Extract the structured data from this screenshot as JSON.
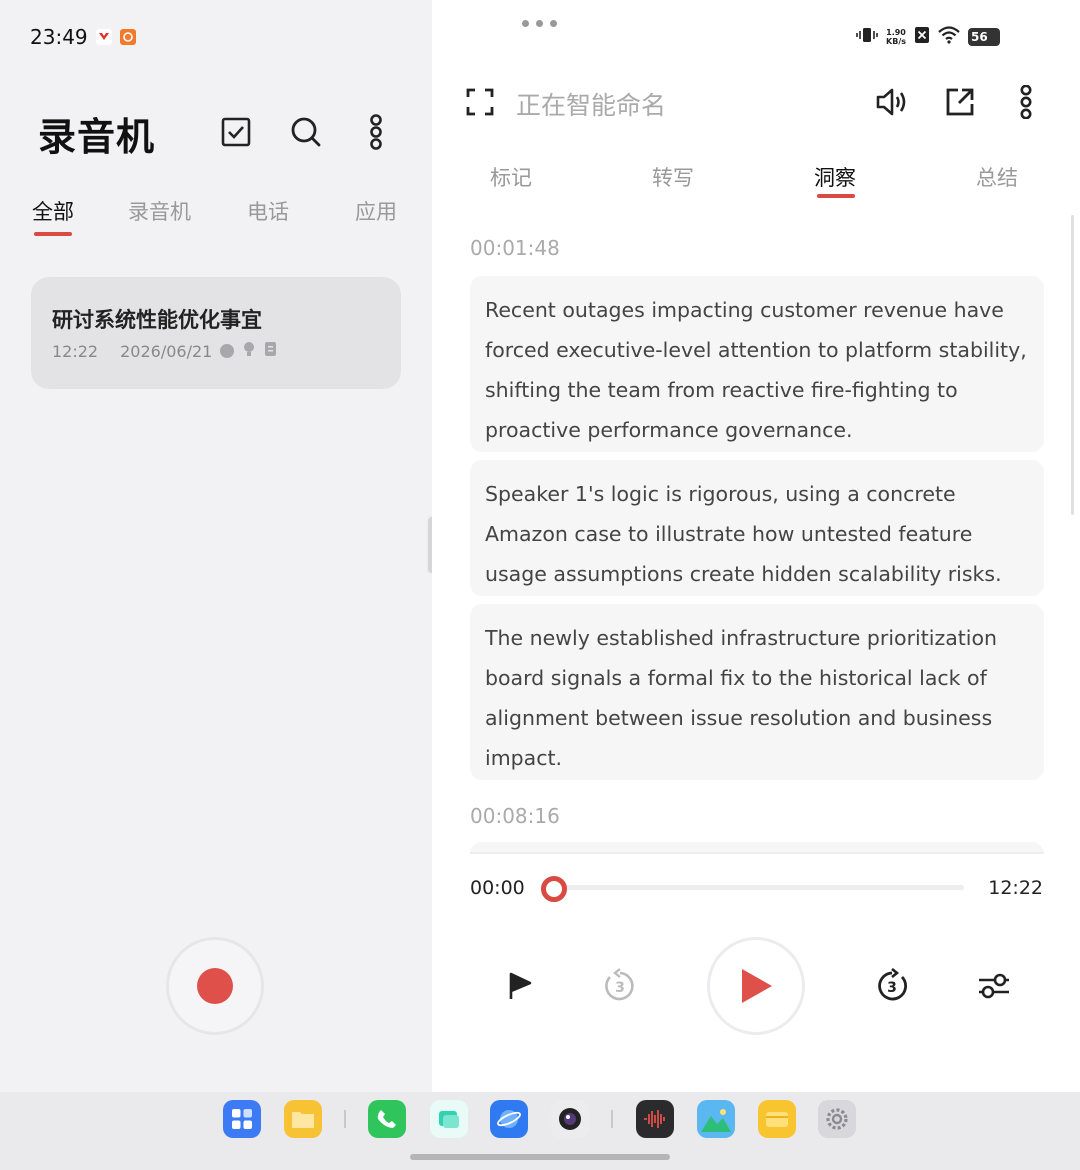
{
  "status_bar": {
    "time": "23:49",
    "net_speed_value": "1.90",
    "net_speed_unit": "KB/s",
    "battery": "56"
  },
  "left_pane": {
    "app_title": "录音机",
    "icons": [
      "checkbox-icon",
      "search-icon",
      "more-icon"
    ],
    "tabs": [
      {
        "label": "全部",
        "active": true
      },
      {
        "label": "录音机",
        "active": false
      },
      {
        "label": "电话",
        "active": false
      },
      {
        "label": "应用",
        "active": false
      }
    ],
    "recording": {
      "title": "研讨系统性能优化事宜",
      "duration": "12:22",
      "date": "2026/06/21",
      "status_icons": [
        "transcript-icon",
        "insight-icon",
        "summary-icon"
      ]
    },
    "record_button_color": "#e0504a"
  },
  "right_pane": {
    "title": "正在智能命名",
    "icons": [
      "fullscreen-icon",
      "speaker-icon",
      "share-icon",
      "more-icon"
    ],
    "tabs": [
      {
        "label": "标记",
        "active": false
      },
      {
        "label": "转写",
        "active": false
      },
      {
        "label": "洞察",
        "active": true
      },
      {
        "label": "总结",
        "active": false
      }
    ],
    "sections": [
      {
        "timestamp": "00:01:48",
        "insights": [
          "Recent outages impacting customer revenue have forced executive-level attention to platform stability, shifting the team from reactive fire-fighting to proactive performance governance.",
          "Speaker 1's logic is rigorous, using a concrete Amazon case to illustrate how untested feature usage assumptions create hidden scalability risks.",
          "The newly established infrastructure prioritization board signals a formal fix to the historical lack of alignment between issue resolution and business impact."
        ]
      },
      {
        "timestamp": "00:08:16",
        "insights": []
      }
    ],
    "player": {
      "current_time": "00:00",
      "total_time": "12:22",
      "progress": 0,
      "controls": [
        "flag-icon",
        "rewind-3-icon",
        "play-icon",
        "forward-3-icon",
        "settings-sliders-icon"
      ]
    },
    "accent_color": "#d84a42"
  },
  "dock": {
    "apps": [
      "app-grid-icon",
      "files-icon",
      "phone-icon",
      "notes-icon",
      "browser-icon",
      "camera-icon",
      "recorder-icon",
      "photos-icon",
      "wallet-icon",
      "settings-icon"
    ]
  }
}
